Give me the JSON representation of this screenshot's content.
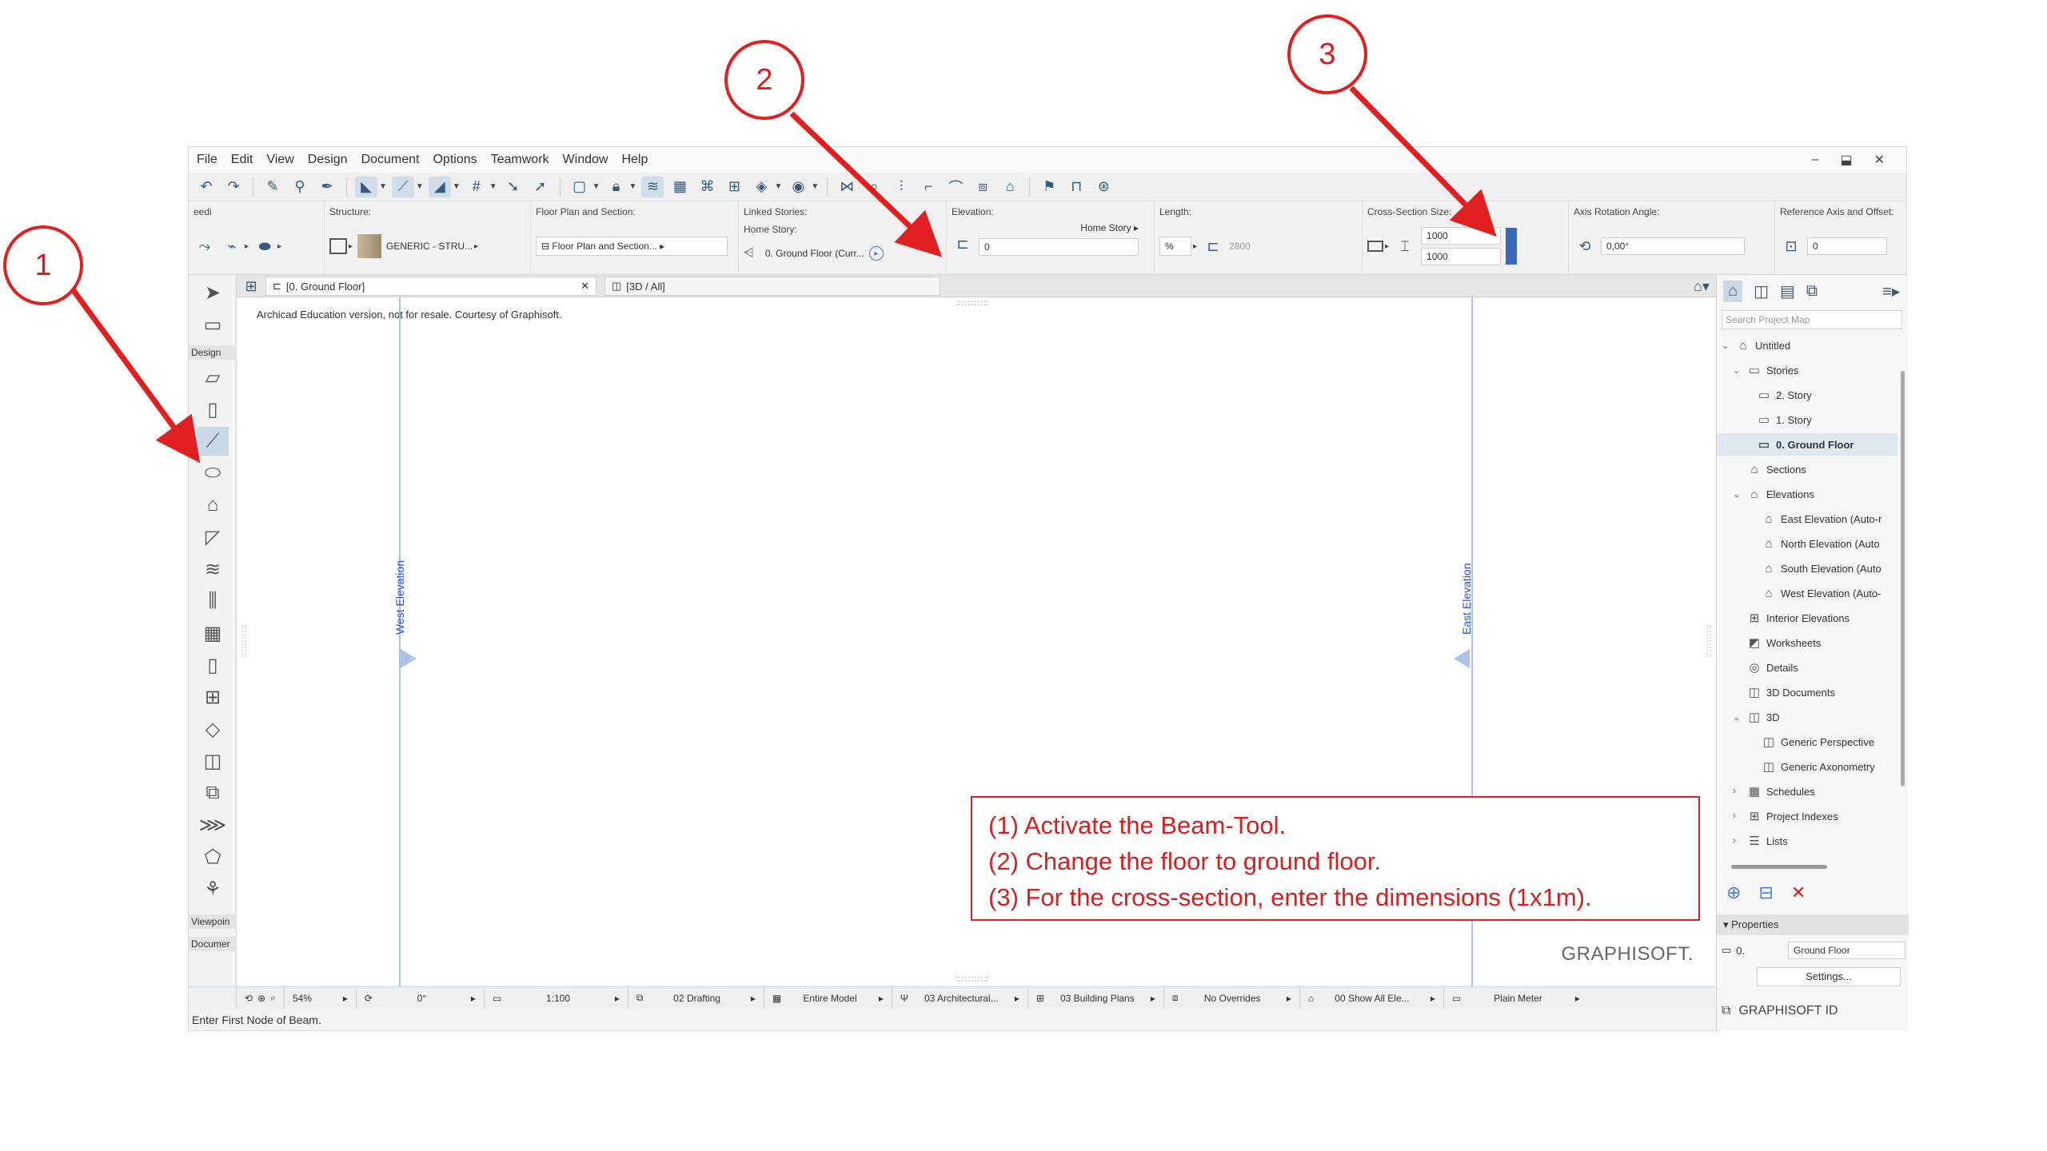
{
  "menu": [
    "File",
    "Edit",
    "View",
    "Design",
    "Document",
    "Options",
    "Teamwork",
    "Window",
    "Help"
  ],
  "window_controls": [
    "–",
    "⬓",
    "✕"
  ],
  "infobox": {
    "label0": "eedi",
    "structure_label": "Structure:",
    "structure_value": "GENERIC - STRU...",
    "floorplan_label": "Floor Plan and Section:",
    "floorplan_value": "Floor Plan and Section...",
    "linked_label": "Linked Stories:",
    "home_story_label": "Home Story:",
    "home_story_value": "0. Ground Floor (Curr...",
    "elevation_label": "Elevation:",
    "elevation_dropdown": "Home Story",
    "elevation_value": "0",
    "length_label": "Length:",
    "length_value": "2800",
    "cross_label": "Cross-Section Size:",
    "cross_w": "1000",
    "cross_h": "1000",
    "axis_label": "Axis Rotation Angle:",
    "axis_value": "0,00°",
    "ref_label": "Reference Axis and Offset:",
    "ref_value": "0"
  },
  "tabs": {
    "floor": "[0. Ground Floor]",
    "threed": "[3D / All]"
  },
  "toolbox": {
    "design_label": "Design",
    "viewpoint_label": "Viewpoin",
    "document_label": "Documer"
  },
  "canvas": {
    "watermark": "Archicad Education version, not for resale. Courtesy of Graphisoft.",
    "west_label": "West Elevation",
    "east_label": "East Elevation",
    "logo": "GRAPHISOFT."
  },
  "statusbar": {
    "zoom": "54%",
    "angle": "0°",
    "scale": "1:100",
    "layer": "02 Drafting",
    "model": "Entire Model",
    "pen": "03 Architectural...",
    "mvo": "03 Building Plans",
    "overrides": "No Overrides",
    "renovation": "00 Show All Ele...",
    "dim": "Plain Meter"
  },
  "hint": "Enter First Node of Beam.",
  "navigator": {
    "search_placeholder": "Search Project Map",
    "items": [
      {
        "label": "Untitled"
      },
      {
        "label": "Stories"
      },
      {
        "label": "2. Story"
      },
      {
        "label": "1. Story"
      },
      {
        "label": "0. Ground Floor"
      },
      {
        "label": "Sections"
      },
      {
        "label": "Elevations"
      },
      {
        "label": "East Elevation (Auto-r"
      },
      {
        "label": "North Elevation (Auto"
      },
      {
        "label": "South Elevation (Auto"
      },
      {
        "label": "West Elevation (Auto-"
      },
      {
        "label": "Interior Elevations"
      },
      {
        "label": "Worksheets"
      },
      {
        "label": "Details"
      },
      {
        "label": "3D Documents"
      },
      {
        "label": "3D"
      },
      {
        "label": "Generic Perspective"
      },
      {
        "label": "Generic Axonometry"
      },
      {
        "label": "Schedules"
      },
      {
        "label": "Project Indexes"
      },
      {
        "label": "Lists"
      }
    ],
    "properties_label": "Properties",
    "prop_id": "0.",
    "prop_name": "Ground Floor",
    "settings": "Settings...",
    "footer": "GRAPHISOFT ID"
  },
  "annotation": {
    "line1": "(1) Activate the Beam-Tool.",
    "line2": "(2) Change the floor to ground floor.",
    "line3": "(3) For the cross-section, enter the dimensions (1x1m)."
  },
  "badges": {
    "b1": "1",
    "b2": "2",
    "b3": "3"
  },
  "colors": {
    "annotation_red": "#e02020",
    "selection_blue": "#c9d8e8",
    "elevation_blue": "#2b4fd8"
  }
}
